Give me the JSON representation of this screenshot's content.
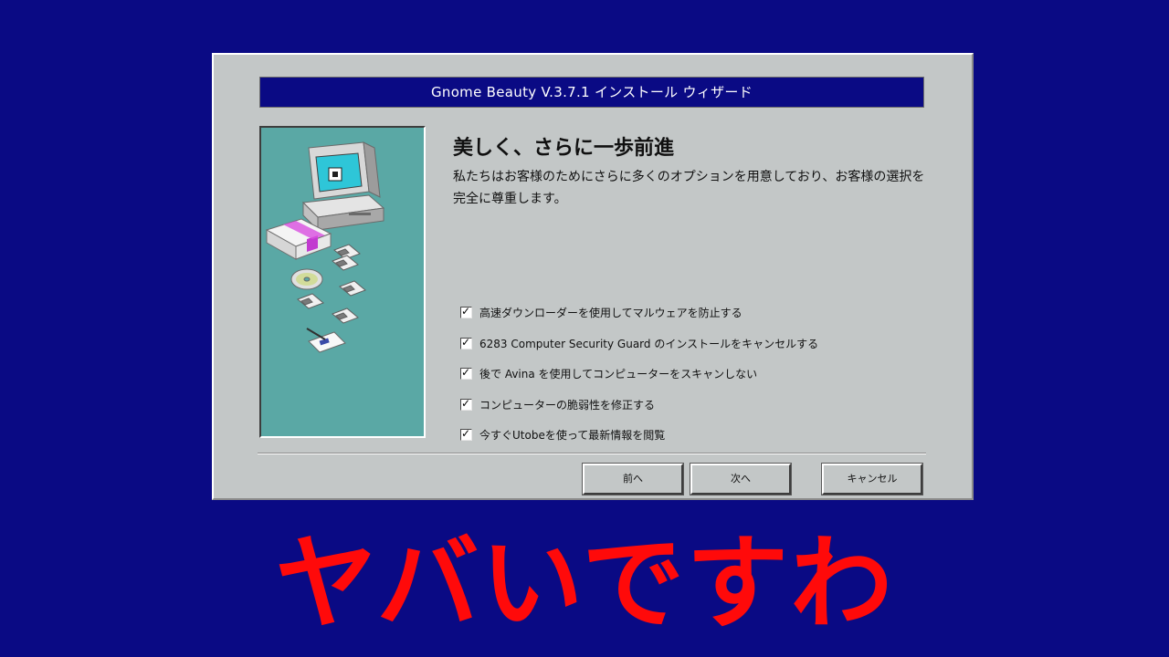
{
  "window": {
    "title": "Gnome Beauty V.3.7.1 インストール ウィザード"
  },
  "page": {
    "heading": "美しく、さらに一歩前進",
    "description": "私たちはお客様のためにさらに多くのオプションを用意しており、お客様の選択を完全に尊重します。"
  },
  "options": [
    {
      "label": "高速ダウンローダーを使用してマルウェアを防止する",
      "checked": true
    },
    {
      "label": "6283 Computer Security Guard のインストールをキャンセルする",
      "checked": true
    },
    {
      "label": "後で Avina を使用してコンピューターをスキャンしない",
      "checked": true
    },
    {
      "label": "コンピューターの脆弱性を修正する",
      "checked": true
    },
    {
      "label": "今すぐUtobeを使って最新情報を閲覧",
      "checked": true
    }
  ],
  "buttons": {
    "back": "前へ",
    "next": "次へ",
    "cancel": "キャンセル"
  },
  "caption": "ヤバいですわ",
  "colors": {
    "background": "#0a0a84",
    "titlebar": "#0a0a84",
    "dialog": "#c3c7c7",
    "side_panel": "#5aa8a5",
    "caption": "#ff0a0a"
  },
  "icons": {
    "side_illustration": "computer-with-software-box-and-disks-illustration",
    "checkbox_mark": "check-mark-icon"
  }
}
